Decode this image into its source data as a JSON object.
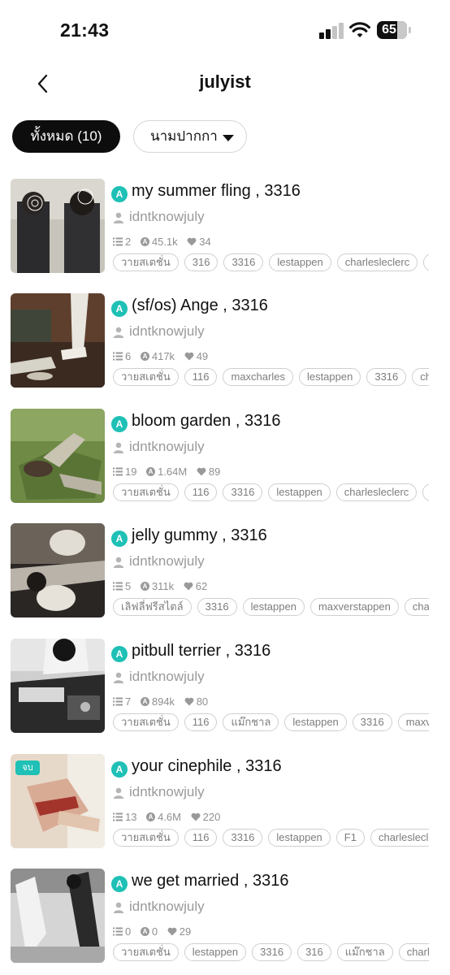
{
  "status_bar": {
    "time": "21:43",
    "battery": "65"
  },
  "header": {
    "title": "julyist"
  },
  "filters": {
    "all_label": "ทั้งหมด (10)",
    "pen_name_label": "นามปากกา"
  },
  "stories": [
    {
      "title": "my summer fling , 3316",
      "audience": "A",
      "author": "idntknowjuly",
      "chapters": "2",
      "views": "45.1k",
      "likes": "34",
      "tags": [
        "วายสเตชั่น",
        "316",
        "3316",
        "lestappen",
        "charlesleclerc",
        "m"
      ]
    },
    {
      "title": "(sf/os) Ange , 3316",
      "audience": "A",
      "author": "idntknowjuly",
      "chapters": "6",
      "views": "417k",
      "likes": "49",
      "tags": [
        "วายสเตชั่น",
        "116",
        "maxcharles",
        "lestappen",
        "3316",
        "char"
      ]
    },
    {
      "title": "bloom garden , 3316",
      "audience": "A",
      "author": "idntknowjuly",
      "chapters": "19",
      "views": "1.64M",
      "likes": "89",
      "tags": [
        "วายสเตชั่น",
        "116",
        "3316",
        "lestappen",
        "charlesleclerc",
        "m"
      ]
    },
    {
      "title": "jelly gummy , 3316",
      "audience": "A",
      "author": "idntknowjuly",
      "chapters": "5",
      "views": "311k",
      "likes": "62",
      "tags": [
        "เลิฟลี่ฟรีสไตล์",
        "3316",
        "lestappen",
        "maxverstappen",
        "charl"
      ]
    },
    {
      "title": "pitbull terrier , 3316",
      "audience": "A",
      "author": "idntknowjuly",
      "chapters": "7",
      "views": "894k",
      "likes": "80",
      "tags": [
        "วายสเตชั่น",
        "116",
        "แม๊กชาล",
        "lestappen",
        "3316",
        "maxvers"
      ]
    },
    {
      "title": "your cinephile , 3316",
      "audience": "A",
      "author": "idntknowjuly",
      "chapters": "13",
      "views": "4.6M",
      "likes": "220",
      "badge": "จบ",
      "tags": [
        "วายสเตชั่น",
        "116",
        "3316",
        "lestappen",
        "F1",
        "charlesleclerc"
      ]
    },
    {
      "title": "we get married , 3316",
      "audience": "A",
      "author": "idntknowjuly",
      "chapters": "0",
      "views": "0",
      "likes": "29",
      "tags": [
        "วายสเตชั่น",
        "lestappen",
        "3316",
        "316",
        "แม๊กชาล",
        "charlesl"
      ]
    }
  ],
  "icons": {
    "back": "chevron-left-icon",
    "chapters": "list-icon",
    "views": "audience-eye-icon",
    "likes": "heart-icon",
    "author": "person-icon",
    "dropdown": "caret-down-icon"
  },
  "colors": {
    "accent": "#1fc0b5",
    "active_filter": "#0d0d0d",
    "muted_text": "#9a9a9a",
    "tag_border": "#cfcfcf"
  }
}
